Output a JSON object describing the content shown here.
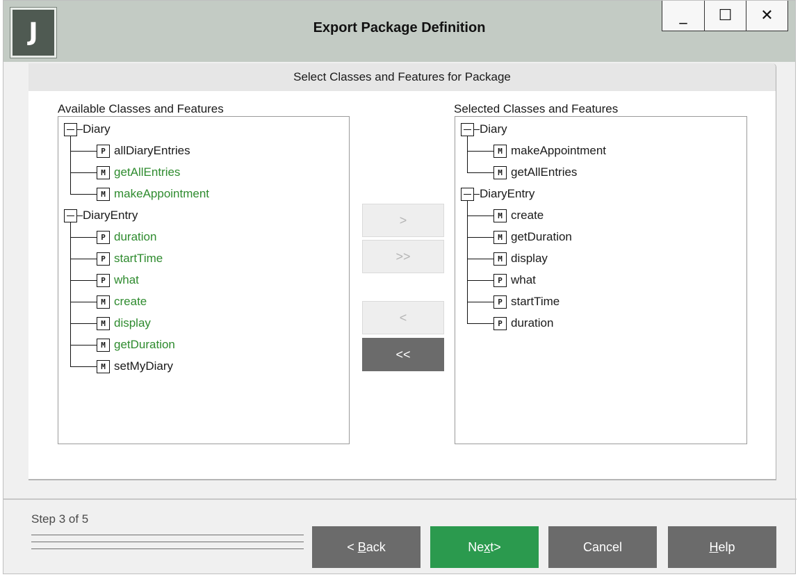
{
  "window": {
    "title": "Export Package Definition",
    "logo_letter": "J",
    "controls": {
      "minimize": "_",
      "maximize": "☐",
      "close": "✕"
    }
  },
  "panel": {
    "header": "Select Classes and Features for Package",
    "available_label": "Available Classes and Features",
    "selected_label": "Selected Classes and Features"
  },
  "available_tree": [
    {
      "class": "Diary",
      "features": [
        {
          "kind": "P",
          "name": "allDiaryEntries",
          "selected": false
        },
        {
          "kind": "M",
          "name": "getAllEntries",
          "selected": true
        },
        {
          "kind": "M",
          "name": "makeAppointment",
          "selected": true
        }
      ]
    },
    {
      "class": "DiaryEntry",
      "features": [
        {
          "kind": "P",
          "name": "duration",
          "selected": true
        },
        {
          "kind": "P",
          "name": "startTime",
          "selected": true
        },
        {
          "kind": "P",
          "name": "what",
          "selected": true
        },
        {
          "kind": "M",
          "name": "create",
          "selected": true
        },
        {
          "kind": "M",
          "name": "display",
          "selected": true
        },
        {
          "kind": "M",
          "name": "getDuration",
          "selected": true
        },
        {
          "kind": "M",
          "name": "setMyDiary",
          "selected": false
        }
      ]
    }
  ],
  "selected_tree": [
    {
      "class": "Diary",
      "features": [
        {
          "kind": "M",
          "name": "makeAppointment"
        },
        {
          "kind": "M",
          "name": "getAllEntries"
        }
      ]
    },
    {
      "class": "DiaryEntry",
      "features": [
        {
          "kind": "M",
          "name": "create"
        },
        {
          "kind": "M",
          "name": "getDuration"
        },
        {
          "kind": "M",
          "name": "display"
        },
        {
          "kind": "P",
          "name": "what"
        },
        {
          "kind": "P",
          "name": "startTime"
        },
        {
          "kind": "P",
          "name": "duration"
        }
      ]
    }
  ],
  "transfer": {
    "add": ">",
    "add_all": ">>",
    "remove": "<",
    "remove_all": "<<"
  },
  "footer": {
    "step": "Step 3 of 5",
    "back_prefix": "< ",
    "back_key": "B",
    "back_rest": "ack",
    "next_prefix": "Ne",
    "next_key": "x",
    "next_rest": "t>",
    "cancel": "Cancel",
    "help_key": "H",
    "help_rest": "elp"
  },
  "colors": {
    "selected_feature_text": "#2e8b2e",
    "primary_button": "#2b9a4e",
    "secondary_button": "#6b6b6b",
    "titlebar": "#c3cbc4"
  }
}
